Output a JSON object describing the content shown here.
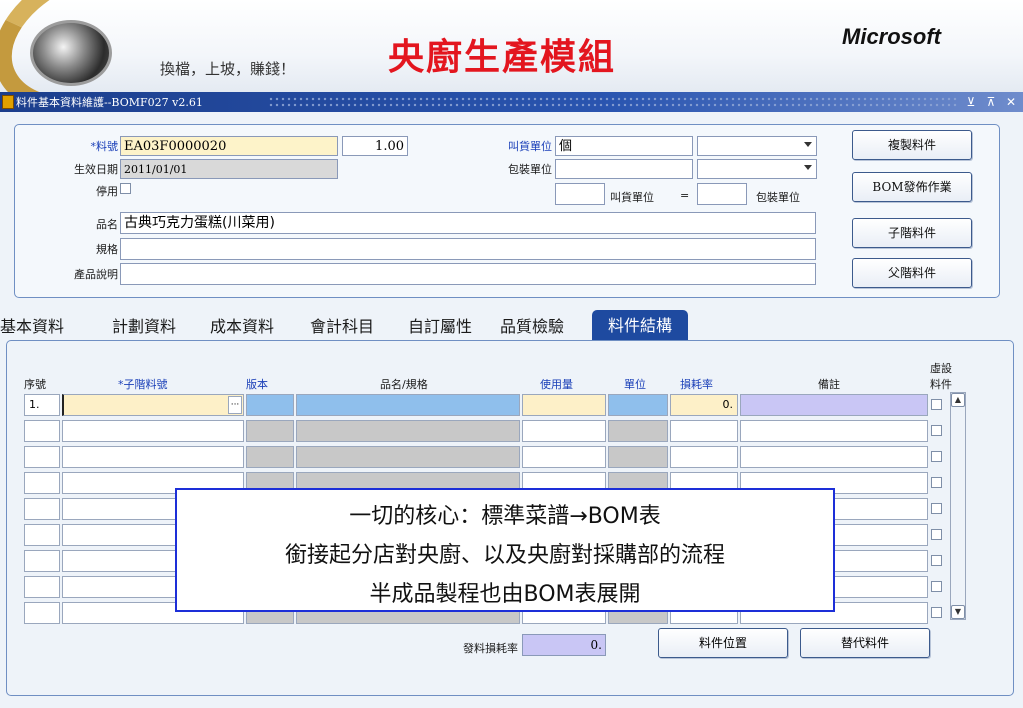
{
  "banner": {
    "slogan": "換檔，上坡，賺錢！",
    "title": "央廚生產模組",
    "brand": "Microsoft"
  },
  "window": {
    "title": "料件基本資料維護--BOMF027 v2.61",
    "controls": [
      "⊻",
      "⊼",
      "✕"
    ]
  },
  "form": {
    "item_no_label": "*料號",
    "item_no": "EA03F0000020",
    "qty": "1.00",
    "effective_date_label": "生效日期",
    "effective_date": "2011/01/01",
    "disabled_label": "停用",
    "name_label": "品名",
    "name": "古典巧克力蛋糕(川菜用)",
    "spec_label": "規格",
    "desc_label": "產品說明",
    "order_unit_label": "叫貨單位",
    "order_unit": "個",
    "pack_unit_label": "包裝單位",
    "conv_order_unit": "叫貨單位",
    "conv_eq": "=",
    "conv_pack_unit": "包裝單位"
  },
  "side_buttons": [
    "複製料件",
    "BOM發佈作業",
    "子階料件",
    "父階料件"
  ],
  "tabs": [
    "基本資料",
    "計劃資料",
    "成本資料",
    "會計科目",
    "自訂屬性",
    "品質檢驗",
    "料件結構"
  ],
  "active_tab": "料件結構",
  "grid": {
    "headers": {
      "seq": "序號",
      "child_no": "*子階料號",
      "version": "版本",
      "name_spec": "品名/規格",
      "usage": "使用量",
      "unit": "單位",
      "loss_rate": "損耗率",
      "note": "備註",
      "virtual_1": "虛設",
      "virtual_2": "料件"
    },
    "rows": [
      {
        "seq": "1.",
        "loss_rate": "0."
      },
      {
        "seq": "",
        "loss_rate": ""
      },
      {
        "seq": "",
        "loss_rate": ""
      },
      {
        "seq": "",
        "loss_rate": ""
      },
      {
        "seq": "",
        "loss_rate": ""
      },
      {
        "seq": "",
        "loss_rate": ""
      },
      {
        "seq": "",
        "loss_rate": ""
      },
      {
        "seq": "",
        "loss_rate": ""
      },
      {
        "seq": "",
        "loss_rate": ""
      },
      {
        "seq": "",
        "loss_rate": ""
      }
    ]
  },
  "issue_loss_label": "發料損耗率",
  "issue_loss_value": "0.",
  "bottom_buttons": [
    "料件位置",
    "替代料件"
  ],
  "callout": [
    "一切的核心：標準菜譜→BOM表",
    "銜接起分店對央廚、以及央廚對採購部的流程",
    "半成品製程也由BOM表展開"
  ],
  "colors": {
    "title_red": "#e3161f",
    "titlebar_blue": "#1c3e8c",
    "tab_active": "#1e4aa0",
    "callout_border": "#1d2fd8"
  }
}
